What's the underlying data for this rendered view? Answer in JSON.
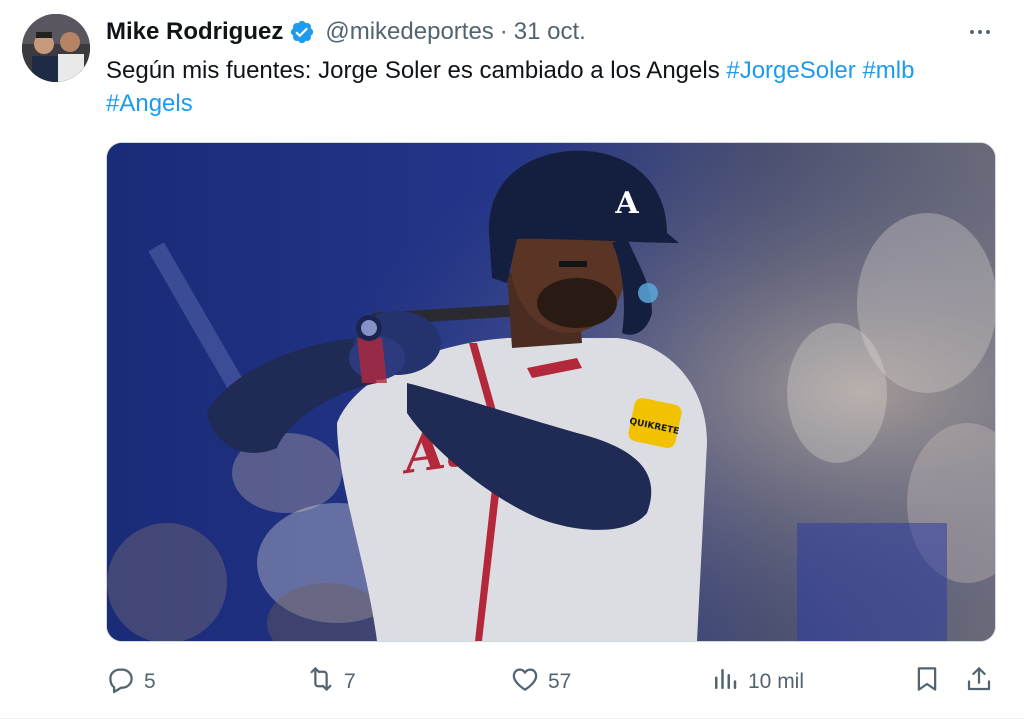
{
  "author": {
    "display_name": "Mike Rodriguez",
    "handle": "@mikedeportes",
    "separator": "·",
    "date": "31 oct."
  },
  "tweet": {
    "text_plain": "Según mis fuentes: Jorge Soler es cambiado a los Angels",
    "hashtags": [
      "#JorgeSoler",
      "#mlb",
      "#Angels"
    ],
    "media": {
      "helmet_logo": "A",
      "patch_text": "QUIKRETE"
    }
  },
  "actions": {
    "replies": "5",
    "reposts": "7",
    "likes": "57",
    "views": "10 mil"
  },
  "icons": {
    "verified": "verified-badge-icon",
    "more": "more-icon",
    "reply": "reply-icon",
    "repost": "repost-icon",
    "like": "heart-icon",
    "views": "views-icon",
    "bookmark": "bookmark-icon",
    "share": "share-icon"
  },
  "colors": {
    "link": "#1d9bf0",
    "text": "#0f1419",
    "secondary": "#536471",
    "verified": "#1d9bf0"
  }
}
